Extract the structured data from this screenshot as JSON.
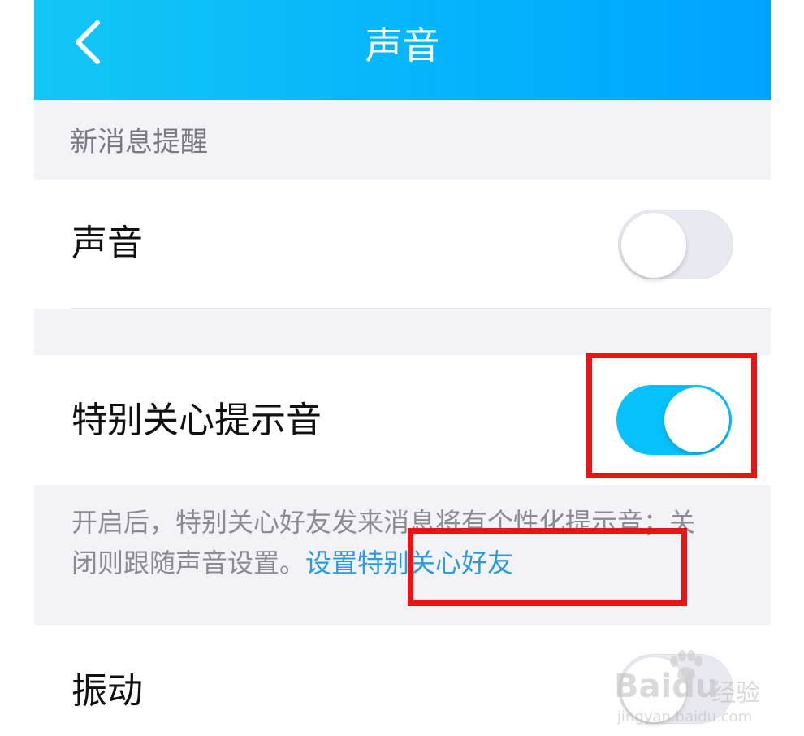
{
  "navbar": {
    "title": "声音",
    "background_gradient": [
      "#12c7f5",
      "#00a4ff"
    ],
    "back_icon": "chevron-left-icon"
  },
  "section": {
    "header": "新消息提醒"
  },
  "settings": {
    "sound": {
      "label": "声音",
      "enabled": false
    },
    "special_care_tone": {
      "label": "特别关心提示音",
      "enabled": true
    },
    "vibration": {
      "label": "振动",
      "enabled": false
    }
  },
  "description": {
    "text": "开启后，特别关心好友发来消息将有个性化提示音；关闭则跟随声音设置。",
    "link": "设置特别关心好友"
  },
  "colors": {
    "accent": "#07c1fb",
    "link": "#2a9bdc",
    "highlight": "#ee1313"
  },
  "watermark": {
    "brand": "Baidu",
    "cn": "经验",
    "url": "jingyan.baidu.com"
  }
}
